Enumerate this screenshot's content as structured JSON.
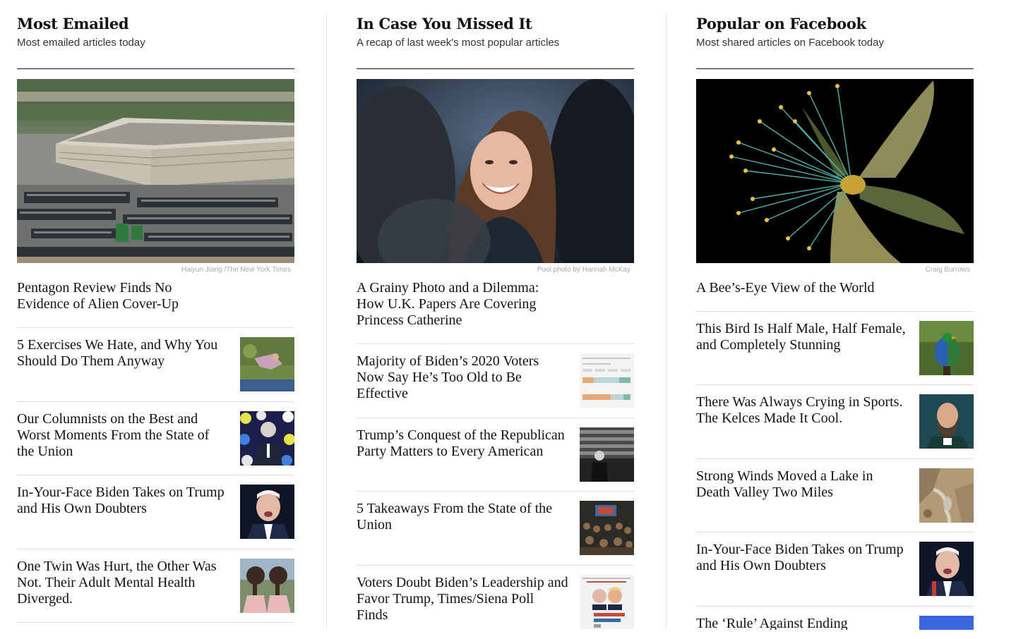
{
  "columns": [
    {
      "heading": "Most Emailed",
      "subheading": "Most emailed articles today",
      "lead": {
        "credit": "Haiyun Jiang /The New York Times",
        "title": "Pentagon Review Finds No Evidence of Alien Cover-Up",
        "image": "pentagon-aerial-photo"
      },
      "items": [
        {
          "title": "5 Exercises We Hate, and Why You Should Do Them Anyway",
          "thumb": "exercise-photo"
        },
        {
          "title": "Our Columnists on the Best and Worst Moments From the State of the Union",
          "thumb": "biden-polka-dot-illustration"
        },
        {
          "title": "In-Your-Face Biden Takes on Trump and His Own Doubters",
          "thumb": "biden-portrait"
        },
        {
          "title": "One Twin Was Hurt, the Other Was Not. Their Adult Mental Health Diverged.",
          "thumb": "twins-braids-photo"
        }
      ]
    },
    {
      "heading": "In Case You Missed It",
      "subheading": "A recap of last week's most popular articles",
      "lead": {
        "credit": "Pool photo by Hannah McKay",
        "title": "A Grainy Photo and a Dilemma: How U.K. Papers Are Covering Princess Catherine",
        "image": "princess-catherine-photo"
      },
      "items": [
        {
          "title": "Majority of Biden’s 2020 Voters Now Say He’s Too Old to Be Effective",
          "thumb": "poll-chart-thumbnail"
        },
        {
          "title": "Trump’s Conquest of the Republican Party Matters to Every American",
          "thumb": "trump-flag-photo"
        },
        {
          "title": "5 Takeaways From the State of the Union",
          "thumb": "state-of-union-room-photo"
        },
        {
          "title": "Voters Doubt Biden’s Leadership and Favor Trump, Times/Siena Poll Finds",
          "thumb": "poll-graphic-thumbnail"
        }
      ]
    },
    {
      "heading": "Popular on Facebook",
      "subheading": "Most shared articles on Facebook today",
      "lead": {
        "credit": "Craig Burrows",
        "title": "A Bee’s-Eye View of the World",
        "image": "ultraviolet-flower-photo"
      },
      "items": [
        {
          "title": "This Bird Is Half Male, Half Female, and Completely Stunning",
          "thumb": "half-green-half-blue-bird"
        },
        {
          "title": "There Was Always Crying in Sports. The Kelces Made It Cool.",
          "thumb": "kelce-portrait"
        },
        {
          "title": "Strong Winds Moved a Lake in Death Valley Two Miles",
          "thumb": "death-valley-aerial"
        },
        {
          "title": "In-Your-Face Biden Takes on Trump and His Own Doubters",
          "thumb": "biden-portrait"
        },
        {
          "title": "The ‘Rule’ Against Ending",
          "thumb": "blue-thumbnail"
        }
      ]
    }
  ]
}
